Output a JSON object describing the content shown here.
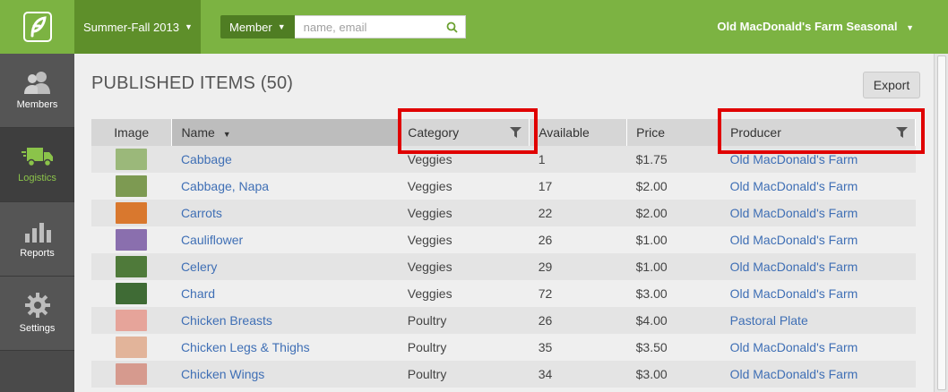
{
  "header": {
    "season_label": "Summer-Fall 2013",
    "member_label": "Member",
    "search_placeholder": "name, email",
    "farm_name": "Old MacDonald's Farm Seasonal"
  },
  "sidebar": {
    "items": [
      {
        "label": "Members",
        "icon": "members-icon"
      },
      {
        "label": "Logistics",
        "icon": "truck-icon"
      },
      {
        "label": "Reports",
        "icon": "bar-chart-icon"
      },
      {
        "label": "Settings",
        "icon": "gear-icon"
      }
    ]
  },
  "page": {
    "title": "PUBLISHED ITEMS (50)",
    "export_label": "Export"
  },
  "table": {
    "columns": [
      "Image",
      "Name",
      "Category",
      "Available",
      "Price",
      "Producer"
    ],
    "rows": [
      {
        "name": "Cabbage",
        "category": "Veggies",
        "available": "1",
        "price": "$1.75",
        "producer": "Old MacDonald's Farm",
        "img_color": "#9bb87a"
      },
      {
        "name": "Cabbage, Napa",
        "category": "Veggies",
        "available": "17",
        "price": "$2.00",
        "producer": "Old MacDonald's Farm",
        "img_color": "#7d9a52"
      },
      {
        "name": "Carrots",
        "category": "Veggies",
        "available": "22",
        "price": "$2.00",
        "producer": "Old MacDonald's Farm",
        "img_color": "#d9782e"
      },
      {
        "name": "Cauliflower",
        "category": "Veggies",
        "available": "26",
        "price": "$1.00",
        "producer": "Old MacDonald's Farm",
        "img_color": "#8a6fae"
      },
      {
        "name": "Celery",
        "category": "Veggies",
        "available": "29",
        "price": "$1.00",
        "producer": "Old MacDonald's Farm",
        "img_color": "#4f7a3a"
      },
      {
        "name": "Chard",
        "category": "Veggies",
        "available": "72",
        "price": "$3.00",
        "producer": "Old MacDonald's Farm",
        "img_color": "#3f6b35"
      },
      {
        "name": "Chicken Breasts",
        "category": "Poultry",
        "available": "26",
        "price": "$4.00",
        "producer": "Pastoral Plate",
        "img_color": "#e6a49a"
      },
      {
        "name": "Chicken Legs & Thighs",
        "category": "Poultry",
        "available": "35",
        "price": "$3.50",
        "producer": "Old MacDonald's Farm",
        "img_color": "#e2b49a"
      },
      {
        "name": "Chicken Wings",
        "category": "Poultry",
        "available": "34",
        "price": "$3.00",
        "producer": "Old MacDonald's Farm",
        "img_color": "#d69a8e"
      }
    ]
  },
  "colors": {
    "brand_green": "#7cb342",
    "link_blue": "#3f6fb5",
    "highlight_red": "#e00000"
  }
}
